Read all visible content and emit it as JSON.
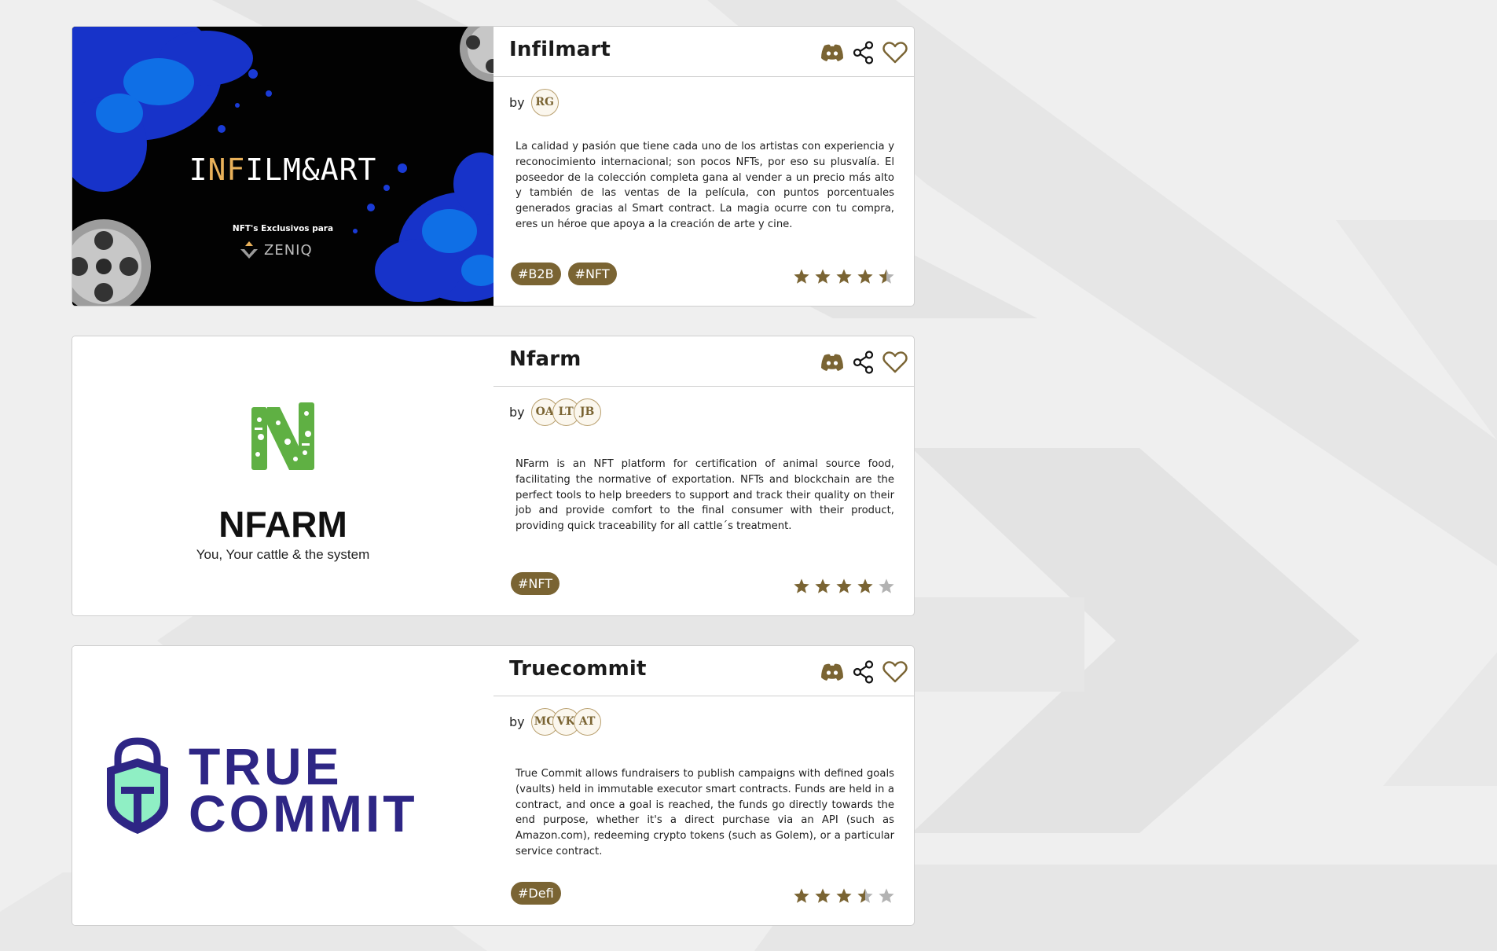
{
  "colors": {
    "accent": "#7a6433",
    "star_empty": "#b3b3b3",
    "background": "#efefef"
  },
  "cards": [
    {
      "title": "Infilmart",
      "by_label": "by",
      "authors": [
        "RG"
      ],
      "description": "La calidad y pasión que tiene cada uno de los artistas con experiencia y reconocimiento internacional; son pocos NFTs, por eso su plusvalía. El poseedor de la colección completa gana al vender a un precio más alto y también de las ventas de la película, con puntos porcentuales generados gracias al Smart contract. La magia ocurre con tu compra, eres un héroe que apoya a la creación de arte y cine.",
      "tags": [
        "#B2B",
        "#NFT"
      ],
      "rating": 4.5,
      "media": {
        "title_a": "I",
        "title_b": "NF",
        "title_c": "ILM&ART",
        "subtitle": "NFT's Exclusivos para",
        "brand": "ZENIQ"
      },
      "icons": [
        "discord-icon",
        "share-icon",
        "heart-icon"
      ]
    },
    {
      "title": "Nfarm",
      "by_label": "by",
      "authors": [
        "OA",
        "LT",
        "JB"
      ],
      "description": "NFarm is an NFT platform for certification of animal source food, facilitating the normative of exportation. NFTs and blockchain are the perfect tools to help breeders to support and track their quality on their job and provide comfort to the final consumer with their product, providing quick traceability for all cattle´s treatment.",
      "tags": [
        "#NFT"
      ],
      "rating": 4,
      "media": {
        "logo_text": "NFARM",
        "tagline": "You, Your cattle & the system"
      },
      "icons": [
        "discord-icon",
        "share-icon",
        "heart-icon"
      ]
    },
    {
      "title": "Truecommit",
      "by_label": "by",
      "authors": [
        "MC",
        "VK",
        "AT"
      ],
      "description": "True Commit allows fundraisers to publish campaigns with defined goals (vaults) held in immutable executor smart contracts. Funds are held in a contract, and once a goal is reached, the funds go directly towards the end purpose, whether it's a direct purchase via an API (such as Amazon.com), redeeming crypto tokens (such as Golem), or a particular service contract.",
      "tags": [
        "#Defi"
      ],
      "rating": 3.5,
      "media": {
        "logo_line1": "TRUE",
        "logo_line2": "COMMIT"
      },
      "icons": [
        "discord-icon",
        "share-icon",
        "heart-icon"
      ]
    }
  ]
}
